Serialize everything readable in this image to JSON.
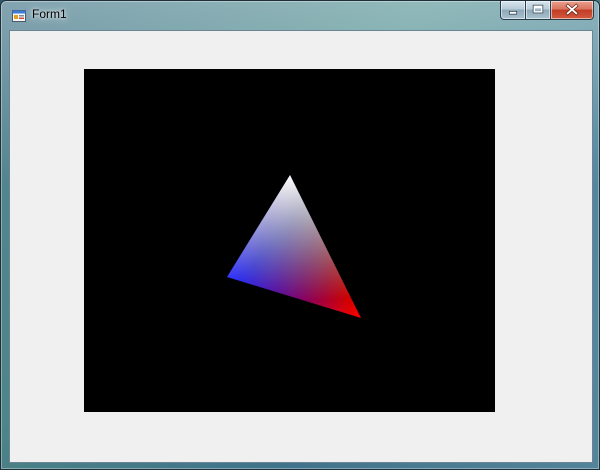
{
  "window": {
    "title": "Form1",
    "icon": "winforms-app-icon",
    "caption_buttons": [
      {
        "name": "minimize",
        "icon": "minimize-icon"
      },
      {
        "name": "maximize",
        "icon": "maximize-icon"
      },
      {
        "name": "close",
        "icon": "close-icon"
      }
    ]
  },
  "canvas": {
    "background": "#000000",
    "triangle": {
      "vertex_colors": [
        "#ffffff",
        "#0000ff",
        "#ff0000"
      ]
    }
  }
}
